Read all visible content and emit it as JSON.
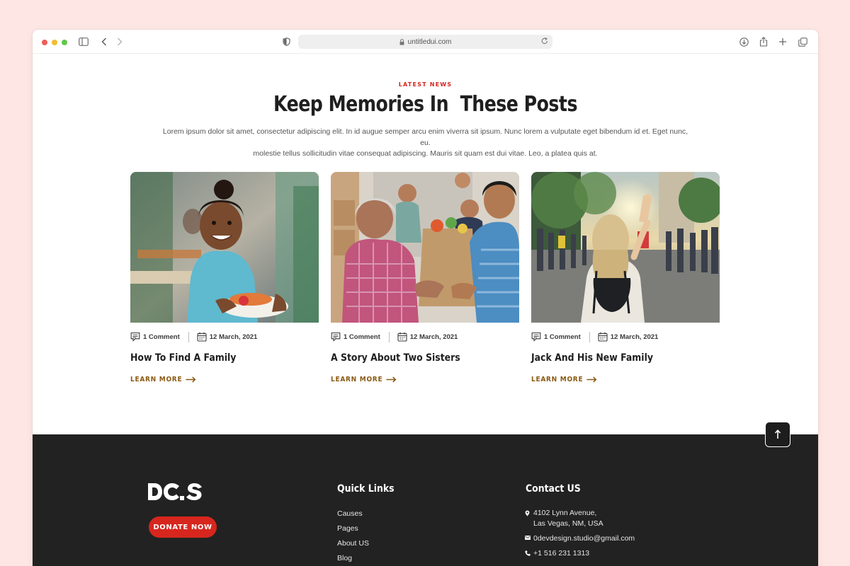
{
  "browser": {
    "url": "untitledui.com"
  },
  "section": {
    "eyebrow": "LATEST NEWS",
    "heading": "Keep Memories In  These Posts",
    "intro_line1": "Lorem ipsum dolor sit amet, consectetur adipiscing elit. In id augue semper arcu enim viverra sit ipsum. Nunc lorem a vulputate eget bibendum id et. Eget nunc, eu.",
    "intro_line2": "molestie tellus sollicitudin vitae consequat adipiscing. Mauris sit quam est dui vitae. Leo, a platea quis at."
  },
  "posts": [
    {
      "comments": "1 Comment",
      "date": "12 March, 2021",
      "title": "How To Find A Family",
      "cta": "LEARN MORE"
    },
    {
      "comments": "1 Comment",
      "date": "12 March, 2021",
      "title": "A Story About Two Sisters",
      "cta": "LEARN MORE"
    },
    {
      "comments": "1 Comment",
      "date": "12 March, 2021",
      "title": "Jack And His New Family",
      "cta": "LEARN MORE"
    }
  ],
  "footer": {
    "donate_label": "DONATE NOW",
    "quick_links_title": "Quick Links",
    "quick_links": [
      "Causes",
      "Pages",
      "About US",
      "Blog"
    ],
    "contact_title": "Contact US",
    "address_line1": "4102 Lynn Avenue,",
    "address_line2": "Las Vegas, NM, USA",
    "email": "0devdesign.studio@gmail.com",
    "phone": "+1 516 231 1313"
  },
  "colors": {
    "page_background": "#fde6e4",
    "accent_red": "#d7261e",
    "learn_more": "#8a5a12",
    "footer_background": "#222222"
  },
  "icons": [
    "sidebar-toggle-icon",
    "back-icon",
    "forward-icon",
    "shield-icon",
    "lock-icon",
    "reload-icon",
    "download-icon",
    "share-icon",
    "new-tab-icon",
    "tabs-overview-icon",
    "comment-icon",
    "calendar-icon",
    "arrow-right-icon",
    "arrow-up-icon",
    "location-pin-icon",
    "mail-icon",
    "phone-icon"
  ]
}
